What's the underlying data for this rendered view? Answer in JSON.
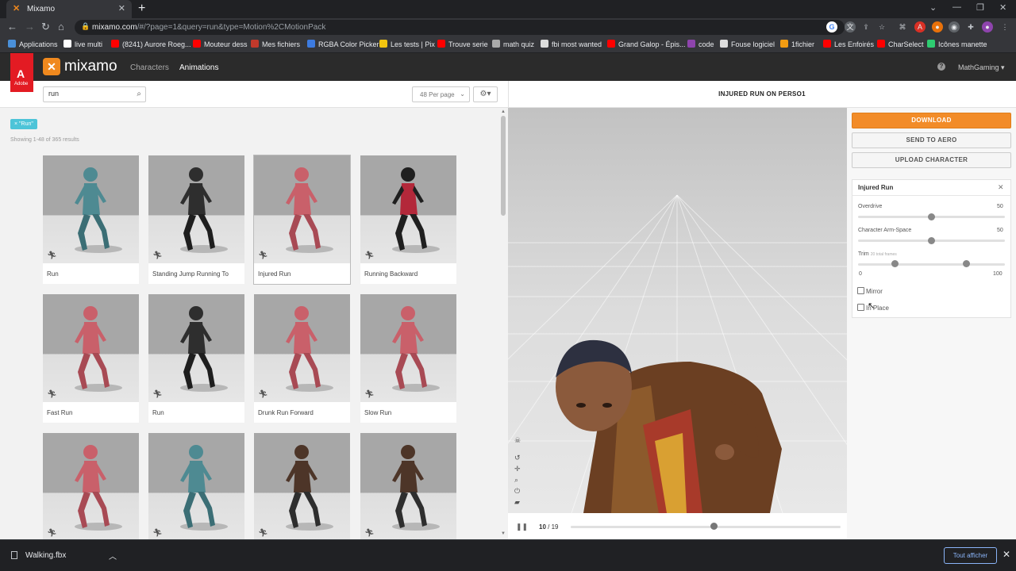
{
  "browser": {
    "tab_title": "Mixamo",
    "url_host": "mixamo.com",
    "url_path": "/#/?page=1&query=run&type=Motion%2CMotionPack",
    "bookmarks": [
      {
        "label": "Applications",
        "color": "#4a90d9"
      },
      {
        "label": "live multi",
        "color": "#ffffff"
      },
      {
        "label": "(8241) Aurore Roeg...",
        "color": "#ff0000"
      },
      {
        "label": "Mouteur dess",
        "color": "#ff0000"
      },
      {
        "label": "Mes fichiers",
        "color": "#c0392b"
      },
      {
        "label": "RGBA Color Picker",
        "color": "#3d7be0"
      },
      {
        "label": "Les tests | Pix",
        "color": "#f1c40f"
      },
      {
        "label": "Trouve serie",
        "color": "#ff0000"
      },
      {
        "label": "math quiz",
        "color": "#aaaaaa"
      },
      {
        "label": "fbi most wanted",
        "color": "#dddddd"
      },
      {
        "label": "Grand Galop - Épis...",
        "color": "#ff0000"
      },
      {
        "label": "code",
        "color": "#8e44ad"
      },
      {
        "label": "Fouse logiciel",
        "color": "#dddddd"
      },
      {
        "label": "1fichier",
        "color": "#f39c12"
      },
      {
        "label": "Les Enfoirés",
        "color": "#ff0000"
      },
      {
        "label": "CharSelect",
        "color": "#ff0000"
      },
      {
        "label": "Icônes manette",
        "color": "#2ecc71"
      }
    ]
  },
  "app": {
    "brand": "mixamo",
    "adobe_mark": "A",
    "adobe_text": "Adobe",
    "nav": {
      "characters": "Characters",
      "animations": "Animations"
    },
    "user": "MathGaming ▾",
    "accent": "#f28c28"
  },
  "library": {
    "search_value": "run",
    "per_page": "48 Per page",
    "filter_tag": "× \"Run\"",
    "results_text": "Showing 1-48 of 365 results",
    "cards": [
      {
        "label": "Run",
        "figure": "teal"
      },
      {
        "label": "Standing Jump Running To",
        "figure": "dark"
      },
      {
        "label": "Injured Run",
        "figure": "pink",
        "selected": true
      },
      {
        "label": "Running Backward",
        "figure": "woman"
      },
      {
        "label": "Fast Run",
        "figure": "pink"
      },
      {
        "label": "Run",
        "figure": "dark"
      },
      {
        "label": "Drunk Run Forward",
        "figure": "pink"
      },
      {
        "label": "Slow Run",
        "figure": "pink"
      },
      {
        "label": "",
        "figure": "pink"
      },
      {
        "label": "",
        "figure": "teal"
      },
      {
        "label": "",
        "figure": "brown"
      },
      {
        "label": "",
        "figure": "brown"
      }
    ]
  },
  "viewer": {
    "title": "INJURED RUN ON PERSO1",
    "frame_current": "10",
    "frame_total": "/ 19",
    "progress": 0.53
  },
  "actions": {
    "download": "DOWNLOAD",
    "send_to_aero": "SEND TO AERO",
    "upload_character": "UPLOAD CHARACTER"
  },
  "settings": {
    "title": "Injured Run",
    "overdrive_label": "Overdrive",
    "overdrive_value": "50",
    "armspace_label": "Character Arm-Space",
    "armspace_value": "50",
    "trim_label": "Trim",
    "trim_sub": "20 total frames",
    "trim_min": "0",
    "trim_max": "100",
    "trim_start": 0.25,
    "trim_end": 0.74,
    "mirror_label": "Mirror",
    "inplace_label": "In Place"
  },
  "downloads": {
    "file": "Walking.fbx",
    "show_all": "Tout afficher"
  }
}
